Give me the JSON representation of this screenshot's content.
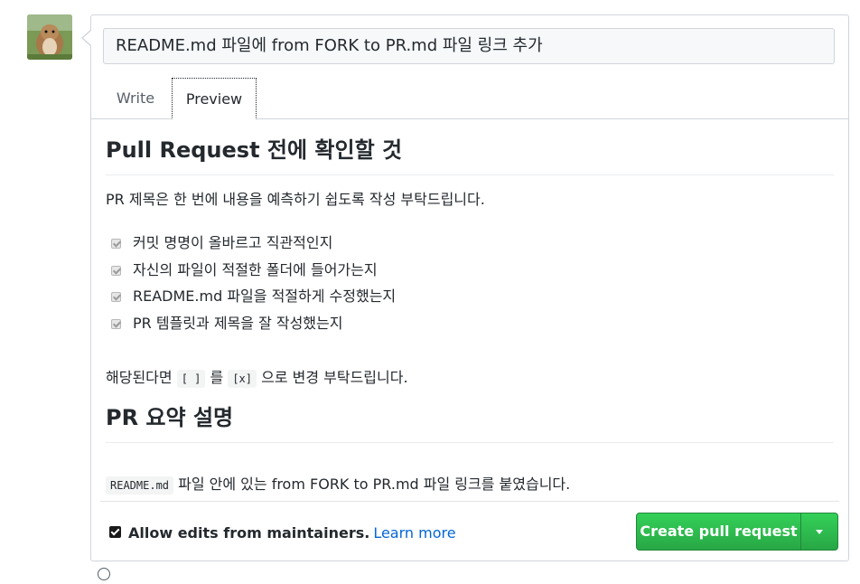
{
  "pr": {
    "title_value": "README.md 파일에 from FORK to PR.md 파일 링크 추가"
  },
  "tabs": {
    "write": "Write",
    "preview": "Preview"
  },
  "preview": {
    "heading1": "Pull Request 전에 확인할 것",
    "intro": "PR 제목은 한 번에 내용을 예측하기 쉽도록 작성 부탁드립니다.",
    "checklist": [
      "커밋 명명이 올바르고 직관적인지",
      "자신의 파일이 적절한 폴더에 들어가는지",
      "README.md 파일을 적절하게 수정했는지",
      "PR 템플릿과 제목을 잘 작성했는지"
    ],
    "note_prefix": "해당된다면",
    "note_code1": "[ ]",
    "note_mid": "를",
    "note_code2": "[x]",
    "note_suffix": "으로 변경 부탁드립니다.",
    "heading2": "PR 요약 설명",
    "summary_code": "README.md",
    "summary_text": "파일 안에 있는 from FORK to PR.md 파일 링크를 붙였습니다."
  },
  "footer": {
    "allow_edits_label": "Allow edits from maintainers.",
    "learn_more": "Learn more",
    "create_button": "Create pull request"
  }
}
